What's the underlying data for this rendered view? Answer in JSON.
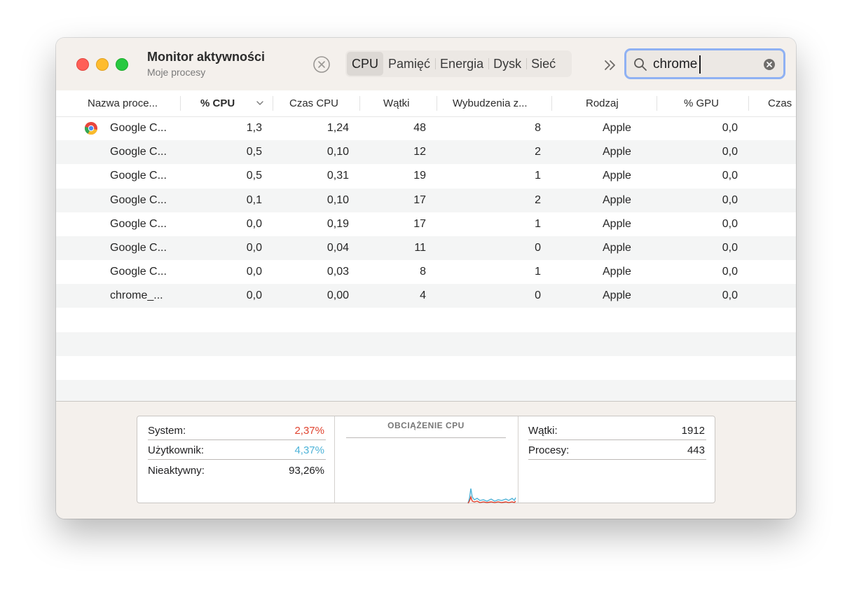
{
  "app": {
    "title": "Monitor aktywności",
    "subtitle": "Moje procesy"
  },
  "tabs": [
    {
      "label": "CPU",
      "active": true
    },
    {
      "label": "Pamięć",
      "active": false
    },
    {
      "label": "Energia",
      "active": false
    },
    {
      "label": "Dysk",
      "active": false
    },
    {
      "label": "Sieć",
      "active": false
    }
  ],
  "search": {
    "value": "chrome"
  },
  "columns": [
    "Nazwa proce...",
    "% CPU",
    "Czas CPU",
    "Wątki",
    "Wybudzenia z...",
    "Rodzaj",
    "% GPU",
    "Czas"
  ],
  "rows": [
    {
      "name": "Google C...",
      "cpu": "1,3",
      "cpu_time": "1,24",
      "threads": "48",
      "wakeups": "8",
      "kind": "Apple",
      "gpu": "0,0",
      "icon": "chrome-icon"
    },
    {
      "name": "Google C...",
      "cpu": "0,5",
      "cpu_time": "0,10",
      "threads": "12",
      "wakeups": "2",
      "kind": "Apple",
      "gpu": "0,0"
    },
    {
      "name": "Google C...",
      "cpu": "0,5",
      "cpu_time": "0,31",
      "threads": "19",
      "wakeups": "1",
      "kind": "Apple",
      "gpu": "0,0"
    },
    {
      "name": "Google C...",
      "cpu": "0,1",
      "cpu_time": "0,10",
      "threads": "17",
      "wakeups": "2",
      "kind": "Apple",
      "gpu": "0,0"
    },
    {
      "name": "Google C...",
      "cpu": "0,0",
      "cpu_time": "0,19",
      "threads": "17",
      "wakeups": "1",
      "kind": "Apple",
      "gpu": "0,0"
    },
    {
      "name": "Google C...",
      "cpu": "0,0",
      "cpu_time": "0,04",
      "threads": "11",
      "wakeups": "0",
      "kind": "Apple",
      "gpu": "0,0"
    },
    {
      "name": "Google C...",
      "cpu": "0,0",
      "cpu_time": "0,03",
      "threads": "8",
      "wakeups": "1",
      "kind": "Apple",
      "gpu": "0,0"
    },
    {
      "name": "chrome_...",
      "cpu": "0,0",
      "cpu_time": "0,00",
      "threads": "4",
      "wakeups": "0",
      "kind": "Apple",
      "gpu": "0,0"
    }
  ],
  "summary": {
    "system_label": "System:",
    "system_value": "2,37%",
    "system_color": "#e0432f",
    "user_label": "Użytkownik:",
    "user_value": "4,37%",
    "user_color": "#4db3d8",
    "idle_label": "Nieaktywny:",
    "idle_value": "93,26%",
    "graph_title": "OBCIĄŻENIE CPU",
    "threads_label": "Wątki:",
    "threads_value": "1912",
    "processes_label": "Procesy:",
    "processes_value": "443"
  }
}
